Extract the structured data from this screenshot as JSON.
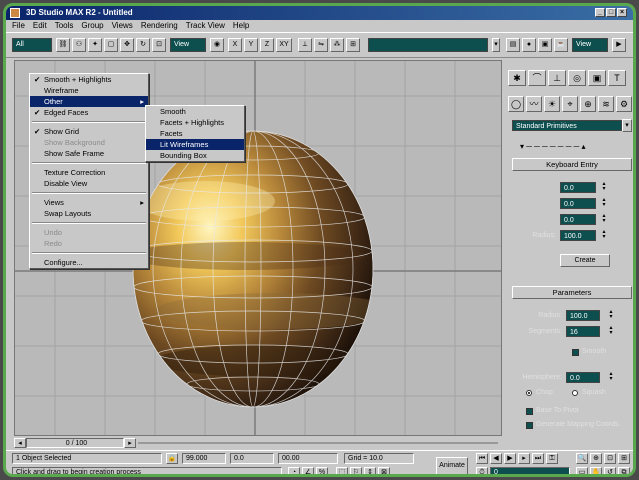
{
  "window": {
    "title": "3D Studio MAX R2 - Untitled"
  },
  "menubar": [
    "File",
    "Edit",
    "Tools",
    "Group",
    "Views",
    "Rendering",
    "Track View",
    "Help"
  ],
  "toolbar": {
    "selection_filter": "All",
    "view_dropdown": "View",
    "axis_x": "X",
    "axis_y": "Y",
    "axis_z": "Z",
    "axis_xy": "XY",
    "named_selection": "",
    "panel_view_dropdown": "View"
  },
  "context_menu": {
    "items": [
      {
        "label": "Smooth + Highlights",
        "checked": true,
        "state": "normal"
      },
      {
        "label": "Wireframe",
        "checked": false,
        "state": "normal"
      },
      {
        "label": "Other",
        "checked": false,
        "state": "selected",
        "submenu": true
      },
      {
        "label": "Edged Faces",
        "checked": true,
        "state": "normal"
      },
      {
        "sep": true
      },
      {
        "label": "Show Grid",
        "checked": true,
        "state": "normal"
      },
      {
        "label": "Show Background",
        "checked": false,
        "state": "disabled"
      },
      {
        "label": "Show Safe Frame",
        "checked": false,
        "state": "normal"
      },
      {
        "sep": true
      },
      {
        "label": "Texture Correction",
        "checked": false,
        "state": "normal"
      },
      {
        "label": "Disable View",
        "checked": false,
        "state": "normal"
      },
      {
        "sep": true
      },
      {
        "label": "Views",
        "checked": false,
        "state": "normal",
        "submenu": true
      },
      {
        "label": "Swap Layouts",
        "checked": false,
        "state": "normal"
      },
      {
        "sep": true
      },
      {
        "label": "Undo",
        "checked": false,
        "state": "disabled"
      },
      {
        "label": "Redo",
        "checked": false,
        "state": "disabled"
      },
      {
        "sep": true
      },
      {
        "label": "Configure...",
        "checked": false,
        "state": "normal"
      }
    ],
    "submenu": [
      {
        "label": "Smooth",
        "state": "normal"
      },
      {
        "label": "Facets + Highlights",
        "state": "normal"
      },
      {
        "label": "Facets",
        "state": "normal"
      },
      {
        "label": "Lit Wireframes",
        "state": "selected"
      },
      {
        "label": "Bounding Box",
        "state": "normal"
      }
    ]
  },
  "command_panel": {
    "object_type": "Standard Primitives",
    "keyboard_entry_title": "Keyboard Entry",
    "kb_x": "0.0",
    "kb_y": "0.0",
    "kb_z": "0.0",
    "kb_radius_label": "Radius:",
    "kb_radius": "100.0",
    "create_button": "Create",
    "parameters_title": "Parameters",
    "radius_label": "Radius:",
    "radius": "100.0",
    "segments_label": "Segments:",
    "segments": "16",
    "smooth_label": "Smooth",
    "hemisphere_label": "Hemisphere:",
    "hemisphere": "0.0",
    "chop_label": "Chop",
    "squash_label": "Squash",
    "base_to_pivot_label": "Base To Pivot",
    "gen_mapping_label": "Generate Mapping Coords."
  },
  "timebar": {
    "frame_readout": "0 / 100"
  },
  "statusbar": {
    "selection_info": "1 Object Selected",
    "prompt": "Click and drag to begin creation process",
    "coord_x": "99.000",
    "coord_y": "0.0",
    "coord_z": "00.00",
    "grid": "Grid = 10.0",
    "animate_label": "Animate",
    "frame_field": "0"
  },
  "colors": {
    "accent": "#0a246a",
    "field": "#0d4f4f",
    "frame_border": "#5aa84e"
  }
}
